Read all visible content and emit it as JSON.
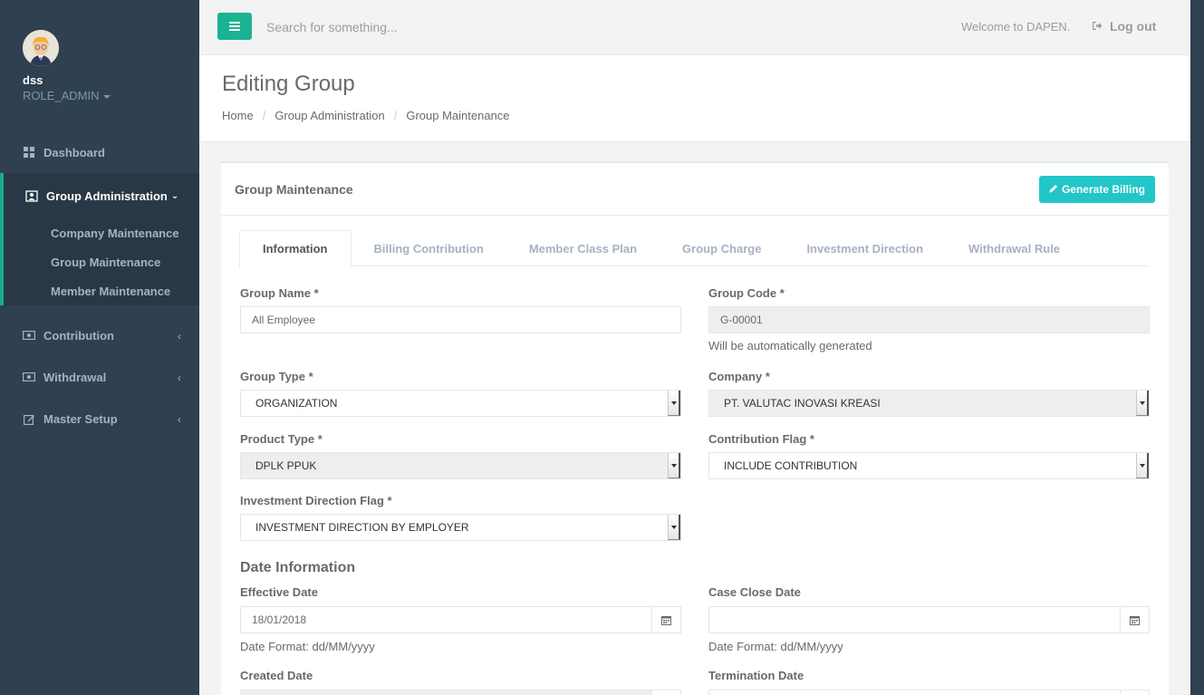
{
  "sidebar": {
    "user_name": "dss",
    "user_role": "ROLE_ADMIN",
    "items": [
      {
        "label": "Dashboard",
        "icon": "dashboard-icon"
      },
      {
        "label": "Group Administration",
        "icon": "group-icon",
        "expanded": true,
        "children": [
          "Company Maintenance",
          "Group Maintenance",
          "Member Maintenance"
        ]
      },
      {
        "label": "Contribution",
        "icon": "money-icon"
      },
      {
        "label": "Withdrawal",
        "icon": "money-icon"
      },
      {
        "label": "Master Setup",
        "icon": "edit-icon"
      }
    ]
  },
  "topbar": {
    "search_placeholder": "Search for something...",
    "welcome": "Welcome to DAPEN.",
    "logout": "Log out"
  },
  "heading": {
    "title": "Editing Group",
    "breadcrumbs": [
      "Home",
      "Group Administration",
      "Group Maintenance"
    ]
  },
  "box": {
    "title": "Group Maintenance",
    "generate_button": "Generate Billing",
    "accent_color": "#23c6c8"
  },
  "tabs": [
    "Information",
    "Billing Contribution",
    "Member Class Plan",
    "Group Charge",
    "Investment Direction",
    "Withdrawal Rule"
  ],
  "form": {
    "group_name_label": "Group Name *",
    "group_name_value": "All Employee",
    "group_code_label": "Group Code *",
    "group_code_value": "G-00001",
    "group_code_help": "Will be automatically generated",
    "group_type_label": "Group Type *",
    "group_type_value": "ORGANIZATION",
    "company_label": "Company *",
    "company_value": "PT. VALUTAC INOVASI KREASI",
    "product_type_label": "Product Type *",
    "product_type_value": "DPLK PPUK",
    "contribution_flag_label": "Contribution Flag *",
    "contribution_flag_value": "INCLUDE CONTRIBUTION",
    "investment_flag_label": "Investment Direction Flag *",
    "investment_flag_value": "INVESTMENT DIRECTION BY EMPLOYER",
    "date_section": "Date Information",
    "effective_date_label": "Effective Date",
    "effective_date_value": "18/01/2018",
    "effective_date_help": "Date Format: dd/MM/yyyy",
    "case_close_label": "Case Close Date",
    "case_close_value": "",
    "case_close_help": "Date Format: dd/MM/yyyy",
    "created_date_label": "Created Date",
    "termination_date_label": "Termination Date"
  },
  "colors": {
    "sidebar_bg": "#2f4050",
    "primary": "#1ab394",
    "info": "#23c6c8"
  }
}
